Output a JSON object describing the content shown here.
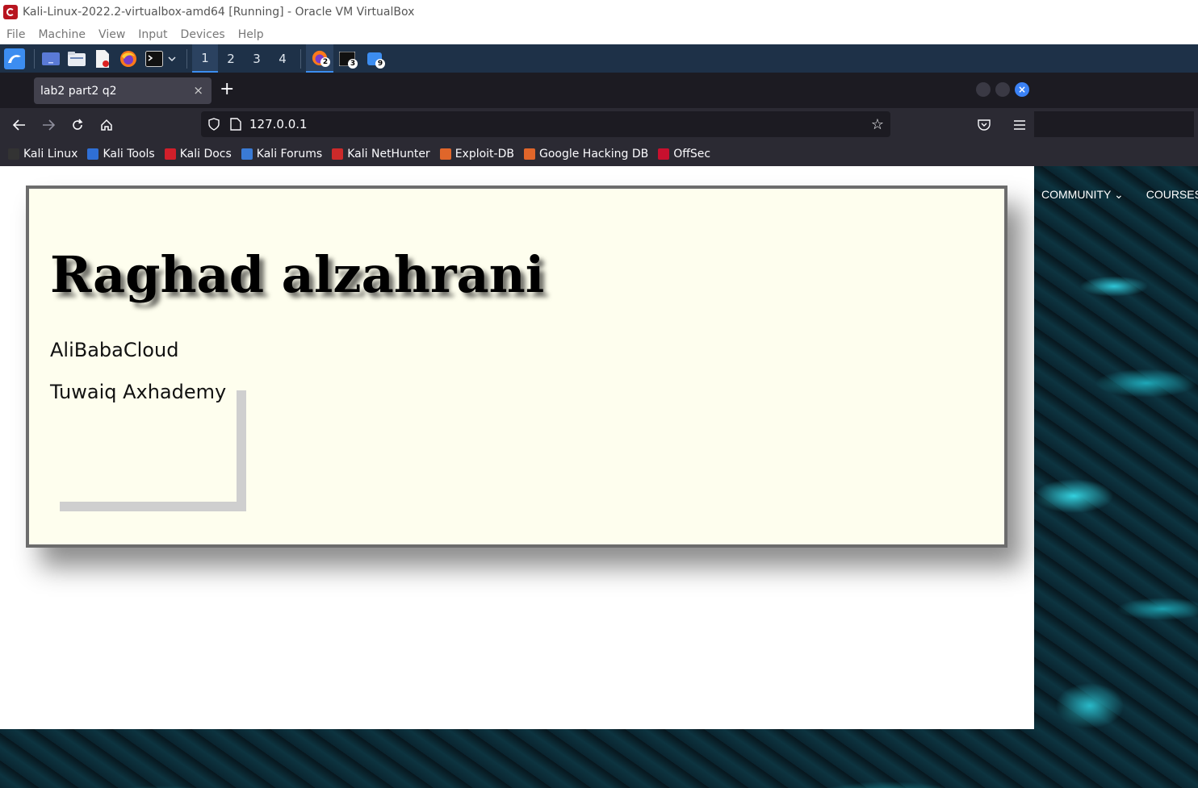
{
  "host_window": {
    "title": "Kali-Linux-2022.2-virtualbox-amd64 [Running] - Oracle VM VirtualBox",
    "menu": [
      "File",
      "Machine",
      "View",
      "Input",
      "Devices",
      "Help"
    ]
  },
  "panel": {
    "workspaces": [
      "1",
      "2",
      "3",
      "4"
    ],
    "active_workspace": "1",
    "task_badges": [
      "2",
      "3",
      "9"
    ]
  },
  "browser": {
    "tab_title": "lab2 part2 q2",
    "tab_close": "×",
    "new_tab": "+",
    "url": "127.0.0.1",
    "bookmarks": [
      {
        "label": "Kali Linux",
        "color": "#333333"
      },
      {
        "label": "Kali Tools",
        "color": "#2f6fd6"
      },
      {
        "label": "Kali Docs",
        "color": "#d11f2a"
      },
      {
        "label": "Kali Forums",
        "color": "#3a7bd5"
      },
      {
        "label": "Kali NetHunter",
        "color": "#cc2a2a"
      },
      {
        "label": "Exploit-DB",
        "color": "#e0662a"
      },
      {
        "label": "Google Hacking DB",
        "color": "#e0662a"
      },
      {
        "label": "OffSec",
        "color": "#c8102e"
      }
    ]
  },
  "page": {
    "heading": "Raghad alzahrani",
    "item1": "AliBabaCloud",
    "item2": "Tuwaiq Axhademy"
  },
  "background_site": {
    "nav": [
      "COMMUNITY",
      "COURSES"
    ]
  },
  "colors": {
    "card_bg": "#fefeee",
    "panel_bg": "#1e3148",
    "accent": "#3c8df0"
  }
}
